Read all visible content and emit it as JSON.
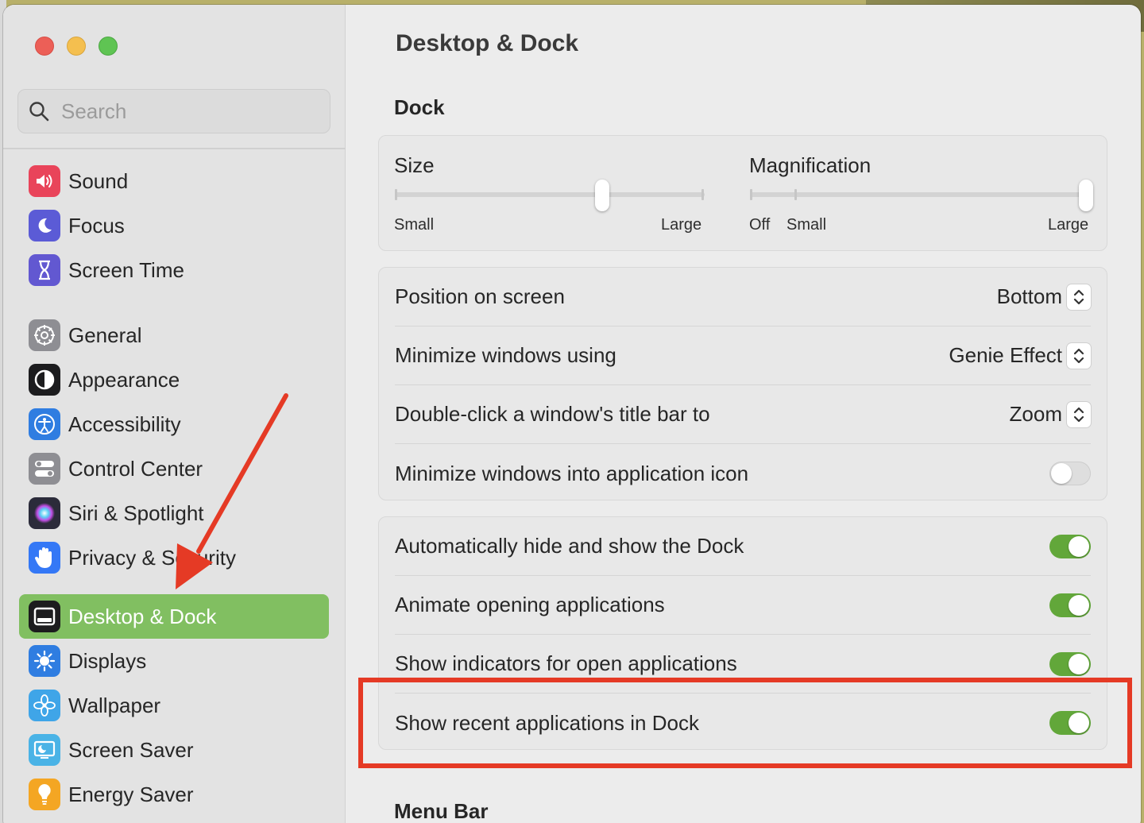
{
  "colors": {
    "accent_green": "#62a73a",
    "sidebar_selected": "#81bf61",
    "annotation_red": "#e53a25"
  },
  "search": {
    "placeholder": "Search"
  },
  "sidebar": {
    "items": [
      {
        "label": "Sound",
        "icon": "speaker-icon",
        "color": "#e9445a"
      },
      {
        "label": "Focus",
        "icon": "moon-icon",
        "color": "#5b5bd6"
      },
      {
        "label": "Screen Time",
        "icon": "hourglass-icon",
        "color": "#6258d1"
      },
      {
        "label": "General",
        "icon": "gear-icon",
        "color": "#8e8e93"
      },
      {
        "label": "Appearance",
        "icon": "appearance-icon",
        "color": "#1c1c1e"
      },
      {
        "label": "Accessibility",
        "icon": "accessibility-icon",
        "color": "#2f7de1"
      },
      {
        "label": "Control Center",
        "icon": "toggles-icon",
        "color": "#8e8e93"
      },
      {
        "label": "Siri & Spotlight",
        "icon": "siri-icon",
        "color": "#2b2b3a"
      },
      {
        "label": "Privacy & Security",
        "icon": "hand-icon",
        "color": "#3478f6"
      },
      {
        "label": "Desktop & Dock",
        "icon": "dock-icon",
        "color": "#1c1c1e",
        "selected": true
      },
      {
        "label": "Displays",
        "icon": "sun-icon",
        "color": "#2f7de1"
      },
      {
        "label": "Wallpaper",
        "icon": "flower-icon",
        "color": "#3fa5e8"
      },
      {
        "label": "Screen Saver",
        "icon": "screensaver-icon",
        "color": "#4ab3e6"
      },
      {
        "label": "Energy Saver",
        "icon": "bulb-icon",
        "color": "#f4a623"
      }
    ]
  },
  "main": {
    "title": "Desktop & Dock",
    "dock_section": "Dock",
    "menubar_section": "Menu Bar",
    "size_slider": {
      "label": "Size",
      "min_label": "Small",
      "max_label": "Large",
      "value_fraction": 0.67
    },
    "magnification_slider": {
      "label": "Magnification",
      "off_label": "Off",
      "min_label": "Small",
      "max_label": "Large",
      "value_fraction": 1.0
    },
    "popups": [
      {
        "label": "Position on screen",
        "value": "Bottom"
      },
      {
        "label": "Minimize windows using",
        "value": "Genie Effect"
      },
      {
        "label": "Double-click a window's title bar to",
        "value": "Zoom"
      }
    ],
    "minimize_into_icon": {
      "label": "Minimize windows into application icon",
      "on": false
    },
    "toggles": [
      {
        "label": "Automatically hide and show the Dock",
        "on": true
      },
      {
        "label": "Animate opening applications",
        "on": true
      },
      {
        "label": "Show indicators for open applications",
        "on": true
      },
      {
        "label": "Show recent applications in Dock",
        "on": true
      }
    ]
  }
}
